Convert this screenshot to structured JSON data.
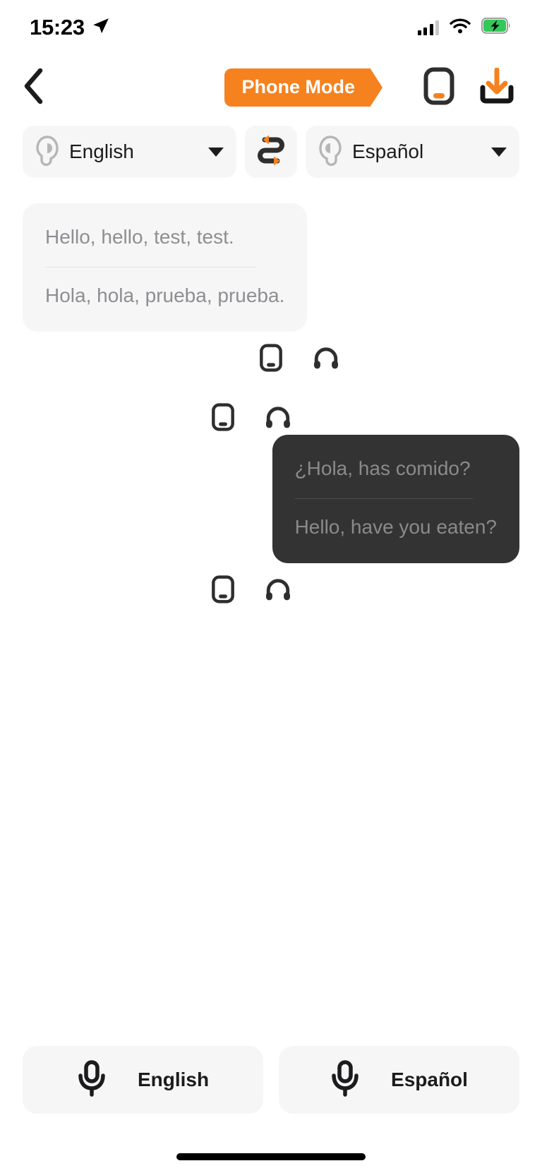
{
  "status_bar": {
    "time": "15:23",
    "location_icon": "location-arrow-icon",
    "signal_icon": "cellular-signal-icon",
    "wifi_icon": "wifi-icon",
    "battery_icon": "battery-charging-icon"
  },
  "nav_bar": {
    "back_icon": "chevron-left-icon",
    "mode_label": "Phone Mode",
    "phone_speaker_icon": "phone-speaker-icon",
    "download_icon": "download-icon"
  },
  "language_bar": {
    "source": {
      "label": "English",
      "earbud_icon": "earbud-left-icon",
      "caret_icon": "chevron-down-icon"
    },
    "swap": {
      "icon": "swap-languages-icon"
    },
    "target": {
      "label": "Español",
      "earbud_icon": "earbud-right-icon",
      "caret_icon": "chevron-down-icon"
    }
  },
  "conversation": {
    "messages": [
      {
        "side": "left",
        "theme": "light",
        "source_text": "Hello, hello, test, test.",
        "translated_text": "Hola, hola, prueba, prueba.",
        "actions": [
          {
            "icon": "phone-speaker-icon"
          },
          {
            "icon": "headphones-icon"
          }
        ]
      },
      {
        "side": "right",
        "theme": "dark",
        "source_text": "¿Hola, has comido?",
        "translated_text": "Hello, have you eaten?",
        "actions": [
          {
            "icon": "phone-speaker-icon"
          },
          {
            "icon": "headphones-icon"
          }
        ]
      }
    ]
  },
  "mic_bar": {
    "buttons": [
      {
        "label": "English",
        "icon": "microphone-icon"
      },
      {
        "label": "Español",
        "icon": "microphone-icon"
      }
    ]
  },
  "colors": {
    "accent_orange": "#F5821F",
    "chip_gray": "#f6f6f6",
    "dark_bubble": "#333333",
    "muted_text": "#8e8e93",
    "battery_green": "#34c759"
  },
  "home_indicator": {
    "visible": true
  }
}
